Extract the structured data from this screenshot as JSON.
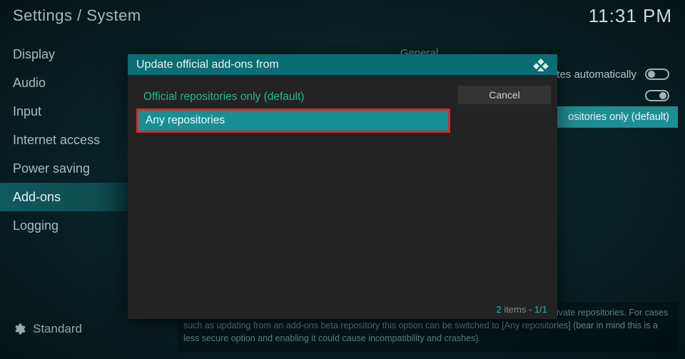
{
  "header": {
    "breadcrumb": "Settings / System",
    "clock": "11:31 PM"
  },
  "sidebar": {
    "items": [
      {
        "label": "Display",
        "active": false
      },
      {
        "label": "Audio",
        "active": false
      },
      {
        "label": "Input",
        "active": false
      },
      {
        "label": "Internet access",
        "active": false
      },
      {
        "label": "Power saving",
        "active": false
      },
      {
        "label": "Add-ons",
        "active": true
      },
      {
        "label": "Logging",
        "active": false
      }
    ]
  },
  "mode": {
    "label": "Standard"
  },
  "content": {
    "section": "General",
    "rows": [
      {
        "label": "updates automatically",
        "value": "",
        "toggle": "off",
        "selected": false
      },
      {
        "label": "",
        "value": "",
        "toggle": "on",
        "selected": false
      },
      {
        "label": "",
        "value": "ositories only (default)",
        "toggle": null,
        "selected": true
      }
    ]
  },
  "help": "By default, add-ons from official repositories will be prevented from being auto-updated from private repositories. For cases such as updating from an add-ons beta repository this option can be switched to [Any repositories] (bear in mind this is a less secure option and enabling it could cause incompatibility and crashes).",
  "modal": {
    "title": "Update official add-ons from",
    "options": [
      {
        "label": "Official repositories only (default)",
        "style": "default"
      },
      {
        "label": "Any repositories",
        "style": "highlight"
      }
    ],
    "cancel": "Cancel",
    "footer_count": "2",
    "footer_items_word": " items - ",
    "footer_page": "1/1"
  }
}
